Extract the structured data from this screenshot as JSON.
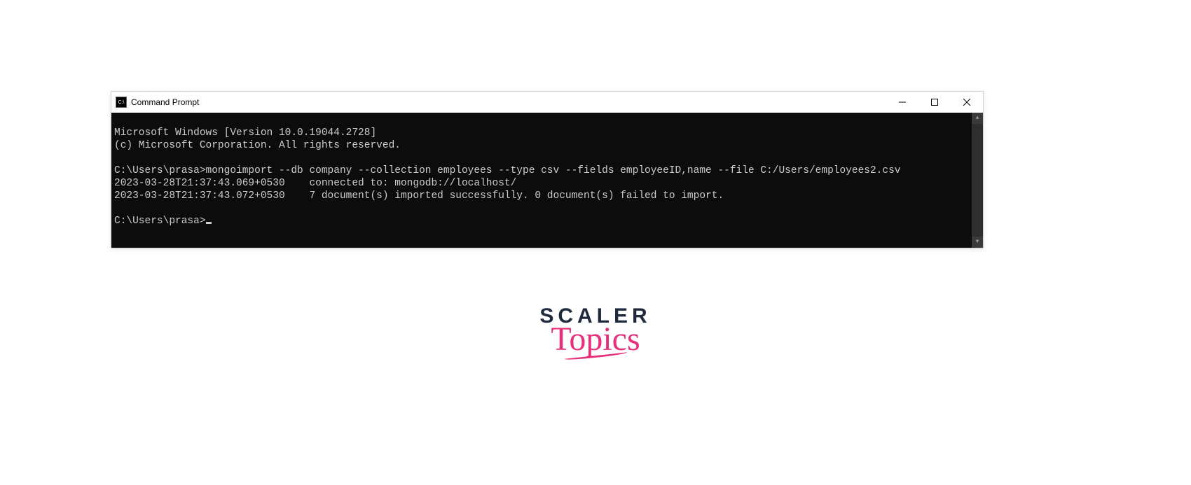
{
  "window": {
    "icon_glyph": "C:\\",
    "title": "Command Prompt"
  },
  "console": {
    "lines": [
      "Microsoft Windows [Version 10.0.19044.2728]",
      "(c) Microsoft Corporation. All rights reserved.",
      "",
      "C:\\Users\\prasa>mongoimport --db company --collection employees --type csv --fields employeeID,name --file C:/Users/employees2.csv",
      "2023-03-28T21:37:43.069+0530    connected to: mongodb://localhost/",
      "2023-03-28T21:37:43.072+0530    7 document(s) imported successfully. 0 document(s) failed to import.",
      ""
    ],
    "prompt": "C:\\Users\\prasa>"
  },
  "logo": {
    "line1": "SCALER",
    "line2": "Topics"
  }
}
